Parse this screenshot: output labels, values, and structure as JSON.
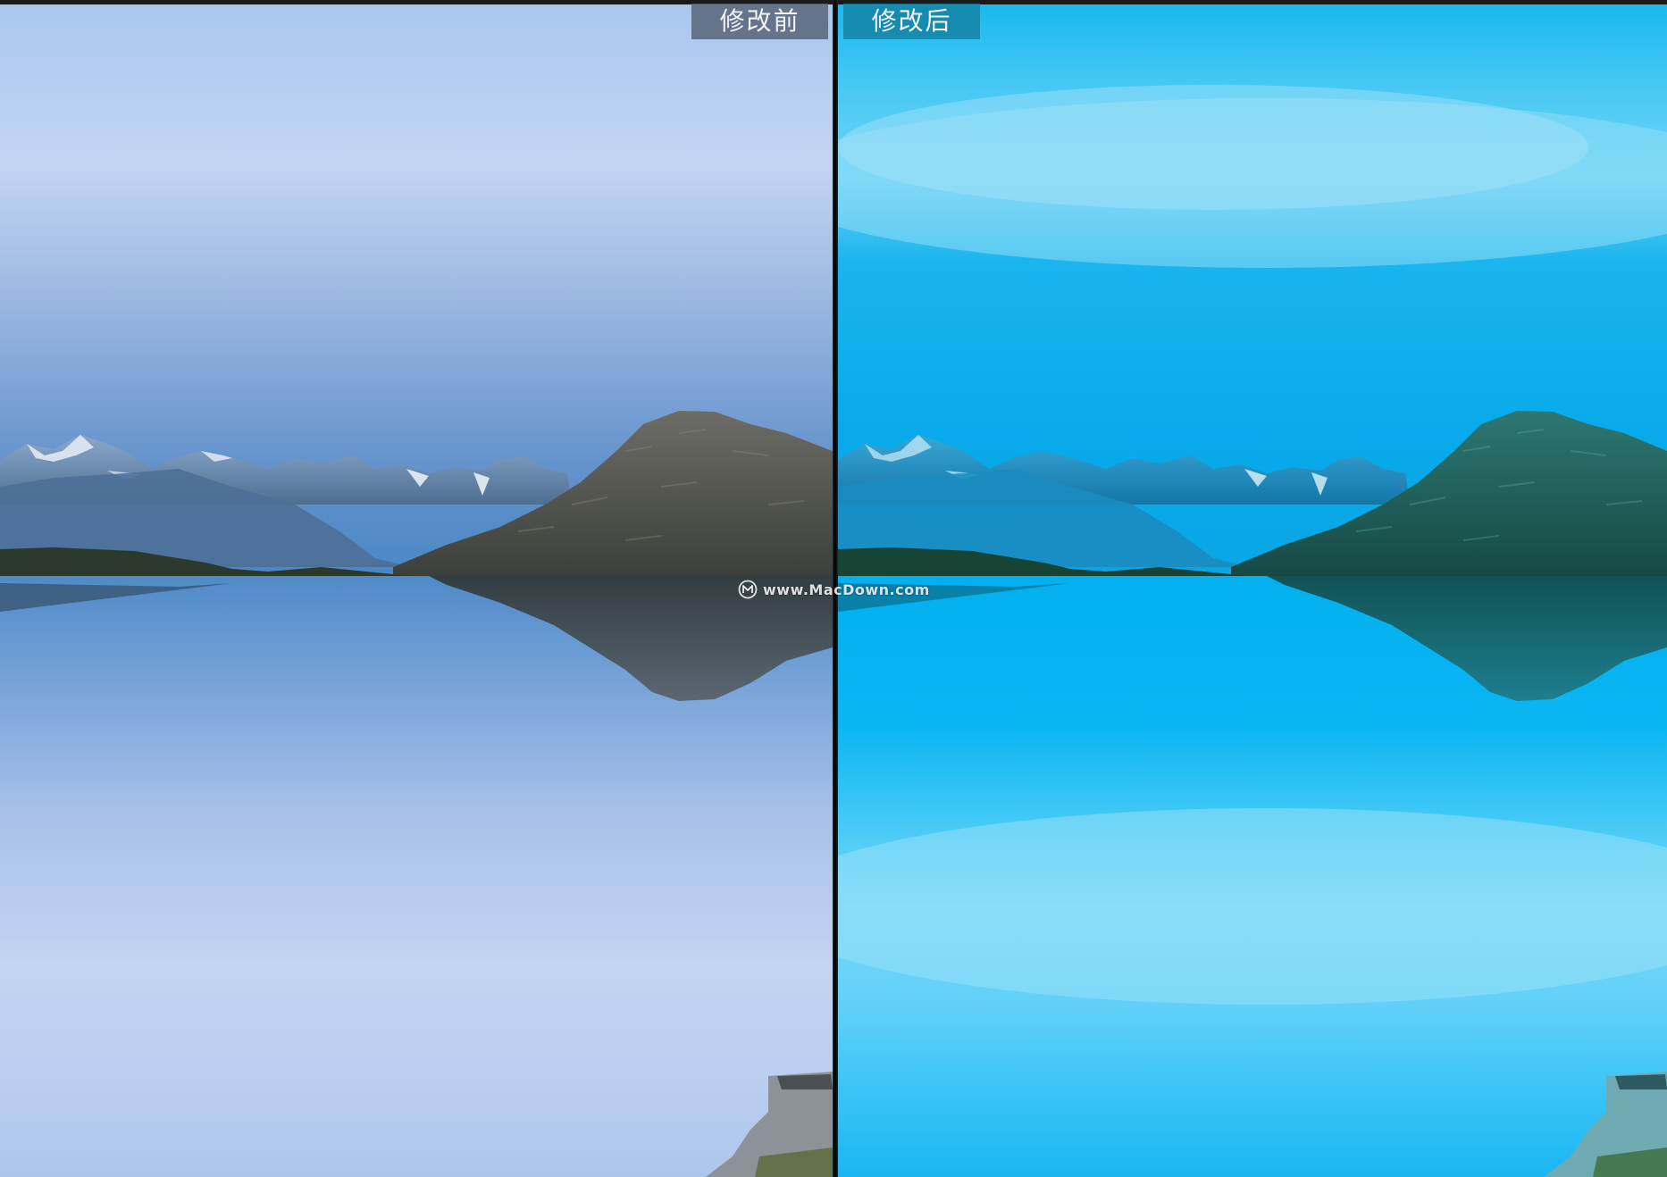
{
  "comparison": {
    "before_label": "修改前",
    "after_label": "修改后"
  },
  "watermark": {
    "text": "www.MacDown.com",
    "icon": "macdown-logo-icon"
  },
  "colors": {
    "before_sky_top": "#aac8ee",
    "before_sky_mid": "#c2d6f2",
    "before_horizon": "#4a86c2",
    "after_sky_top": "#5ad0f6",
    "after_horizon": "#0aaef0",
    "after_water_bottom": "#4fd3fa",
    "divider": "#050505"
  }
}
